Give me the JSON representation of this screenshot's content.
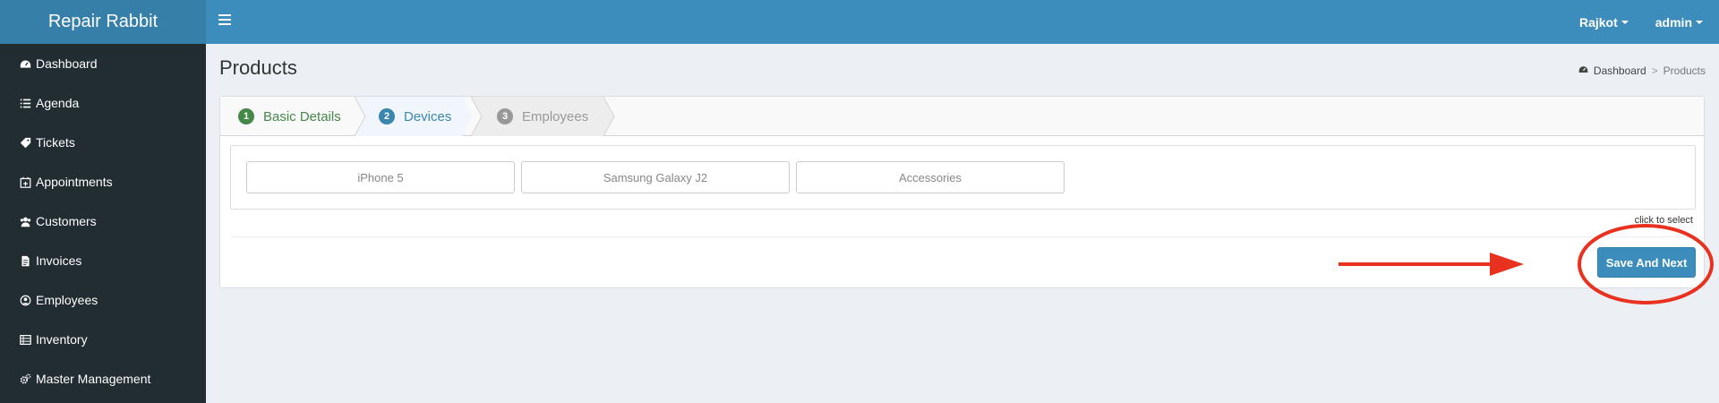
{
  "header": {
    "brand": "Repair Rabbit",
    "location_menu": "Rajkot",
    "user_menu": "admin"
  },
  "sidebar": {
    "items": [
      {
        "label": "Dashboard",
        "icon": "dashboard-icon"
      },
      {
        "label": "Agenda",
        "icon": "list-icon"
      },
      {
        "label": "Tickets",
        "icon": "tag-icon"
      },
      {
        "label": "Appointments",
        "icon": "calendar-plus-icon"
      },
      {
        "label": "Customers",
        "icon": "users-icon"
      },
      {
        "label": "Invoices",
        "icon": "file-icon"
      },
      {
        "label": "Employees",
        "icon": "user-circle-icon"
      },
      {
        "label": "Inventory",
        "icon": "table-icon"
      },
      {
        "label": "Master Management",
        "icon": "cogs-icon"
      }
    ]
  },
  "page": {
    "title": "Products",
    "breadcrumb": {
      "home": "Dashboard",
      "separator": ">",
      "current": "Products"
    }
  },
  "wizard": {
    "steps": [
      {
        "number": "1",
        "label": "Basic Details",
        "state": "complete"
      },
      {
        "number": "2",
        "label": "Devices",
        "state": "active"
      },
      {
        "number": "3",
        "label": "Employees",
        "state": "pending"
      }
    ],
    "devices": [
      "iPhone 5",
      "Samsung Galaxy J2",
      "Accessories"
    ],
    "hint": "click to select",
    "save_label": "Save And Next"
  },
  "colors": {
    "topbar": "#3c8dbc",
    "sidebar": "#222d32",
    "step_complete": "#468847",
    "step_active": "#3a87ad",
    "annotation": "#e8321f"
  }
}
